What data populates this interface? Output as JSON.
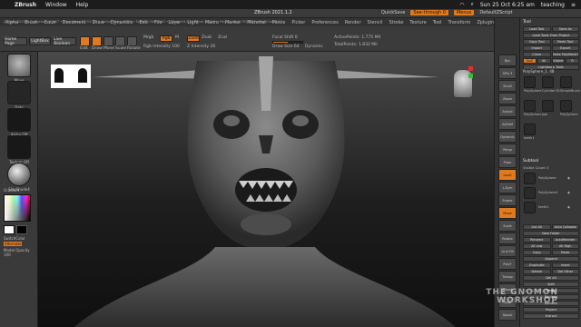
{
  "macos": {
    "app_name": "ZBrush",
    "menus": [
      "Window",
      "Help"
    ],
    "clock": "Sun 25 Oct 6:25 am",
    "user": "teaching"
  },
  "zbrush": {
    "title": "ZBrush 2021.1.2",
    "info": "ZBrush 2021.1.2 quicksave_007 • Free Mem 12.53 GB • Active Mem 4916 • Scratch Disk 190 • ZTime 16.014 Timer 0.016 • PolyCount 1.792 MP • MeshCount 2",
    "right_items": [
      "QuickSave",
      "See-through 0",
      "Menus",
      "DefaultZScript"
    ],
    "menus": [
      "Alpha",
      "Brush",
      "Color",
      "Document",
      "Draw",
      "Dynamics",
      "Edit",
      "File",
      "Layer",
      "Light",
      "Macro",
      "Marker",
      "Material",
      "Movie",
      "Picker",
      "Preferences",
      "Render",
      "Stencil",
      "Stroke",
      "Texture",
      "Tool",
      "Transform",
      "Zplugin",
      "Zscript",
      "Help"
    ],
    "toolbar": {
      "home_page": "Home Page",
      "lightbox": "LightBox",
      "live_boolean": "Live Boolean",
      "edit": "Edit",
      "draw": "Draw",
      "move": "Move",
      "scale": "Scale",
      "rotate": "Rotate",
      "mrgb": "Mrgb",
      "rgb": "Rgb",
      "m": "M",
      "rgb_intensity": "Rgb Intensity 100",
      "zadd": "Zadd",
      "zsub": "Zsub",
      "zcut": "Zcut",
      "z_intensity": "Z Intensity 26",
      "focal_shift": "Focal Shift 0",
      "draw_size": "Draw Size 64",
      "dynamic": "Dynamic",
      "active_points": "ActivePoints: 1.775 Mil",
      "total_points": "TotalPoints: 1.832 Mil"
    },
    "left_panel": [
      {
        "label": "Move"
      },
      {
        "label": "Dots"
      },
      {
        "label": "Alpha Off"
      },
      {
        "label": "Texture Off"
      },
      {
        "label": "SkinShade4"
      },
      {
        "label": "Gradient"
      },
      {
        "label": "SwitchColor"
      },
      {
        "label": "Alternate"
      },
      {
        "label": "Model Opacity 100"
      }
    ],
    "shelf": [
      "Bpr",
      "SPix 3",
      "Scroll",
      "Zoom",
      "Actual",
      "AAHalf",
      "Dynamic",
      "Persp",
      "Floor",
      "Local",
      "L.Sym",
      "Frame",
      "Move",
      "Scale",
      "Rotate",
      "Line Fill",
      "PolyF",
      "Transp",
      "Ghost",
      "Solo",
      "Xpose"
    ],
    "tray": {
      "header": "Tool",
      "rows1": [
        [
          "Load Tool",
          "Save As"
        ],
        [
          "Load Tools From Project"
        ],
        [
          "Copy Tool",
          "Paste Tool"
        ],
        [
          "Import",
          "Export"
        ],
        [
          "Clone",
          "Make PolyMesh3D"
        ],
        [
          "GoZ",
          "All",
          "Visible",
          "R"
        ],
        [
          "Lightbox ▸ Tools"
        ]
      ],
      "current_tool": "PolySphere_1. 48",
      "tools": [
        "PolySphere",
        "Cylinder3D",
        "SimpleBrush",
        "PolySphere",
        "Jaw",
        "PolySphere",
        "teeth1"
      ],
      "subtool_header": "Subtool",
      "visible_count": "Visible Count 3",
      "subtools": [
        "PolySphere",
        "PolySphere1",
        "teeth1"
      ],
      "rows2": [
        [
          "List All",
          "Auto Collapse"
        ],
        [
          "New Folder"
        ],
        [
          "Rename",
          "AutoReorder"
        ],
        [
          "All Low",
          "All High"
        ],
        [
          "Copy",
          "Paste"
        ],
        [
          "Append"
        ],
        [
          "Duplicate",
          "Insert"
        ],
        [
          "Delete",
          "Del Other"
        ],
        [
          "Del All"
        ],
        [
          "Split"
        ],
        [
          "Merge"
        ],
        [
          "Boolean"
        ],
        [
          "Remesh"
        ],
        [
          "Project"
        ],
        [
          "Extract"
        ]
      ]
    }
  },
  "watermark": [
    "THE GNOMON",
    "WORKSHOP"
  ]
}
